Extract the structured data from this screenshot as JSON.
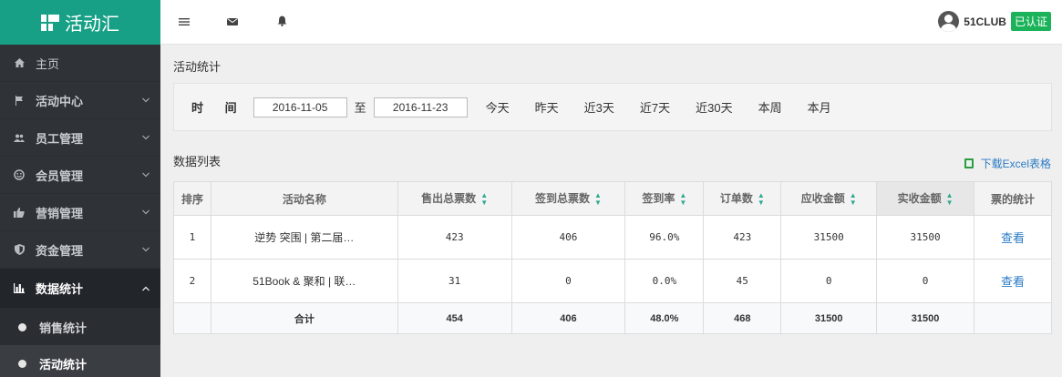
{
  "app": {
    "name": "活动汇"
  },
  "header": {
    "icons": [
      "menu-icon",
      "mail-icon",
      "bell-icon"
    ],
    "user_name": "51CLUB",
    "verified_badge": "已认证"
  },
  "sidebar": {
    "items": [
      {
        "label": "主页",
        "icon": "home-icon"
      },
      {
        "label": "活动中心",
        "icon": "flag-icon"
      },
      {
        "label": "员工管理",
        "icon": "users-icon"
      },
      {
        "label": "会员管理",
        "icon": "smile-icon"
      },
      {
        "label": "营销管理",
        "icon": "thumbs-up-icon"
      },
      {
        "label": "资金管理",
        "icon": "shield-icon"
      },
      {
        "label": "数据统计",
        "icon": "bar-chart-icon"
      }
    ],
    "sub_items": [
      {
        "label": "销售统计"
      },
      {
        "label": "活动统计"
      }
    ]
  },
  "main": {
    "page_title": "活动统计",
    "filter": {
      "time_label": "时 间",
      "start_date": "2016-11-05",
      "to_label": "至",
      "end_date": "2016-11-23",
      "quick": [
        "今天",
        "昨天",
        "近3天",
        "近7天",
        "近30天",
        "本周",
        "本月"
      ]
    },
    "list_title": "数据列表",
    "excel_link": "下载Excel表格",
    "table": {
      "headers": [
        "排序",
        "活动名称",
        "售出总票数",
        "签到总票数",
        "签到率",
        "订单数",
        "应收金额",
        "实收金额",
        "票的统计"
      ],
      "rows": [
        {
          "index": "1",
          "name": "逆势 突围 | 第二届…",
          "sold": "423",
          "checked_in": "406",
          "rate": "96.0%",
          "orders": "423",
          "receivable": "31500",
          "received": "31500",
          "action": "查看"
        },
        {
          "index": "2",
          "name": "51Book & 聚和 | 联…",
          "sold": "31",
          "checked_in": "0",
          "rate": "0.0%",
          "orders": "45",
          "receivable": "0",
          "received": "0",
          "action": "查看"
        }
      ],
      "total": {
        "label": "合计",
        "sold": "454",
        "checked_in": "406",
        "rate": "48.0%",
        "orders": "468",
        "receivable": "31500",
        "received": "31500"
      }
    }
  }
}
